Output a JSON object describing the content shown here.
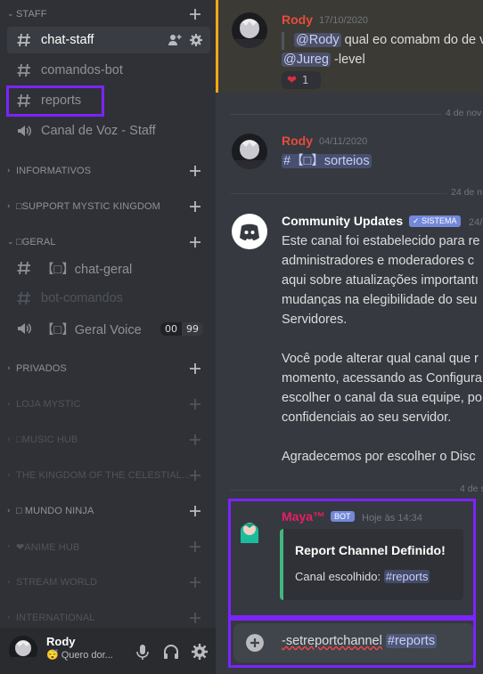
{
  "sidebar": {
    "staff_category": "STAFF",
    "channels_staff": [
      {
        "label": "chat-staff"
      },
      {
        "label": "comandos-bot"
      },
      {
        "label": "reports"
      },
      {
        "label": "Canal de Voz - Staff"
      }
    ],
    "categories": [
      {
        "label": "INFORMATIVOS"
      },
      {
        "label": "□SUPPORT MYSTIC KINGDOM"
      },
      {
        "label": "□GERAL"
      },
      {
        "label": "PRIVADOS"
      },
      {
        "label": "LOJA MYSTIC"
      },
      {
        "label": "□MUSIC HUB"
      },
      {
        "label": "THE KINGDOM OF THE CELESTIAL..."
      },
      {
        "label": "□ MUNDO NINJA"
      },
      {
        "label": "❤ANIME HUB"
      },
      {
        "label": "STREAM WORLD"
      },
      {
        "label": "INTERNATIONAL"
      }
    ],
    "channels_geral": [
      {
        "label": "【□】chat-geral"
      },
      {
        "label": "bot-comandos"
      },
      {
        "label": "【□】Geral Voice"
      }
    ],
    "voice_count": {
      "current": "00",
      "limit": "99"
    },
    "user": {
      "name": "Rody",
      "status": "😴 Quero dor..."
    }
  },
  "chat": {
    "messages": [
      {
        "author": "Rody",
        "timestamp": "17/10/2020",
        "reply_mention": "@Rody",
        "reply_text": "qual eo comabm do de v",
        "mention": "@Jureg",
        "text": "-level",
        "reaction_count": "1"
      },
      {
        "author": "Rody",
        "timestamp": "04/11/2020",
        "channel_link": "#【□】sorteios"
      },
      {
        "author": "Community Updates",
        "badge": "✓ SISTEMA",
        "timestamp": "24/",
        "lines": [
          "Este canal foi estabelecido para re",
          "administradores e moderadores c",
          "aqui sobre atualizações importantı",
          "mudanças na elegibilidade do seu",
          "Servidores.",
          "",
          "Você pode alterar qual canal que r",
          "momento, acessando as Configura",
          "escolher o canal da sua equipe, po",
          "confidenciais ao seu servidor.",
          "",
          "Agradecemos por escolher o Disc"
        ]
      },
      {
        "author": "Maya™",
        "badge": "BOT",
        "timestamp": "Hoje às 14:34",
        "embed_title": "Report Channel Definido!",
        "embed_label": "Canal escolhido:",
        "embed_channel": "#reports"
      }
    ],
    "dividers": [
      "4 de nov",
      "24 de n",
      "4 de s"
    ],
    "composer_text": "-setreportchannel",
    "composer_mention": "#reports"
  },
  "colors": {
    "accent": "#7289da",
    "highlight": "#7b24ff",
    "author_red": "#e74c3c",
    "bot_pink": "#e91e63"
  }
}
